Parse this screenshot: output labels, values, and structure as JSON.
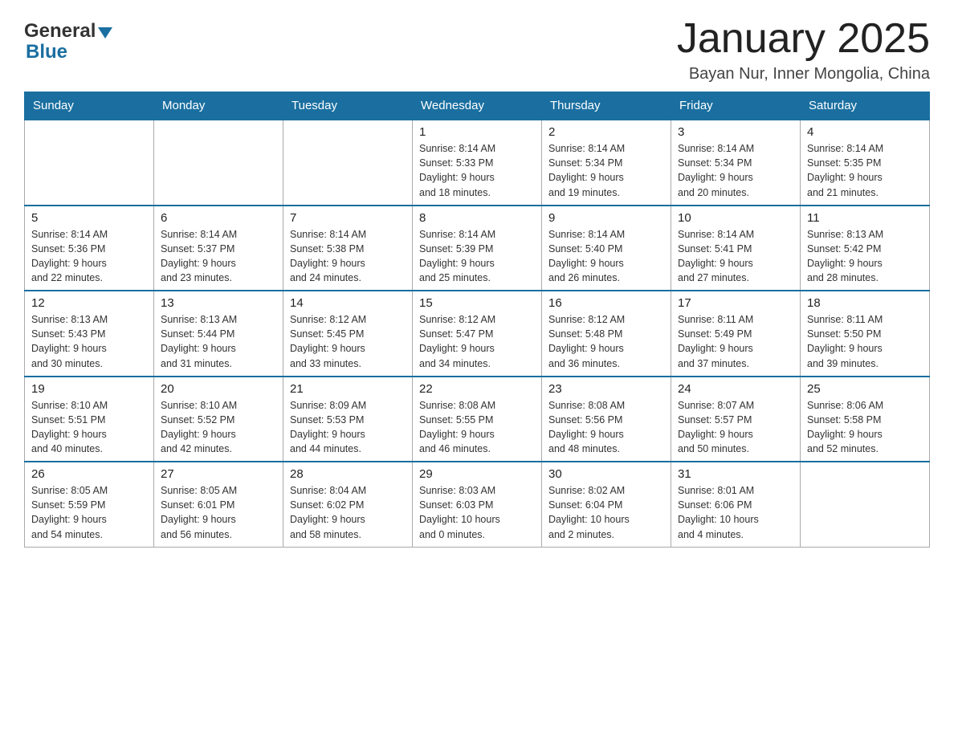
{
  "header": {
    "logo_general": "General",
    "logo_blue": "Blue",
    "month_title": "January 2025",
    "location": "Bayan Nur, Inner Mongolia, China"
  },
  "calendar": {
    "days_of_week": [
      "Sunday",
      "Monday",
      "Tuesday",
      "Wednesday",
      "Thursday",
      "Friday",
      "Saturday"
    ],
    "weeks": [
      {
        "days": [
          {
            "number": "",
            "info": ""
          },
          {
            "number": "",
            "info": ""
          },
          {
            "number": "",
            "info": ""
          },
          {
            "number": "1",
            "info": "Sunrise: 8:14 AM\nSunset: 5:33 PM\nDaylight: 9 hours\nand 18 minutes."
          },
          {
            "number": "2",
            "info": "Sunrise: 8:14 AM\nSunset: 5:34 PM\nDaylight: 9 hours\nand 19 minutes."
          },
          {
            "number": "3",
            "info": "Sunrise: 8:14 AM\nSunset: 5:34 PM\nDaylight: 9 hours\nand 20 minutes."
          },
          {
            "number": "4",
            "info": "Sunrise: 8:14 AM\nSunset: 5:35 PM\nDaylight: 9 hours\nand 21 minutes."
          }
        ]
      },
      {
        "days": [
          {
            "number": "5",
            "info": "Sunrise: 8:14 AM\nSunset: 5:36 PM\nDaylight: 9 hours\nand 22 minutes."
          },
          {
            "number": "6",
            "info": "Sunrise: 8:14 AM\nSunset: 5:37 PM\nDaylight: 9 hours\nand 23 minutes."
          },
          {
            "number": "7",
            "info": "Sunrise: 8:14 AM\nSunset: 5:38 PM\nDaylight: 9 hours\nand 24 minutes."
          },
          {
            "number": "8",
            "info": "Sunrise: 8:14 AM\nSunset: 5:39 PM\nDaylight: 9 hours\nand 25 minutes."
          },
          {
            "number": "9",
            "info": "Sunrise: 8:14 AM\nSunset: 5:40 PM\nDaylight: 9 hours\nand 26 minutes."
          },
          {
            "number": "10",
            "info": "Sunrise: 8:14 AM\nSunset: 5:41 PM\nDaylight: 9 hours\nand 27 minutes."
          },
          {
            "number": "11",
            "info": "Sunrise: 8:13 AM\nSunset: 5:42 PM\nDaylight: 9 hours\nand 28 minutes."
          }
        ]
      },
      {
        "days": [
          {
            "number": "12",
            "info": "Sunrise: 8:13 AM\nSunset: 5:43 PM\nDaylight: 9 hours\nand 30 minutes."
          },
          {
            "number": "13",
            "info": "Sunrise: 8:13 AM\nSunset: 5:44 PM\nDaylight: 9 hours\nand 31 minutes."
          },
          {
            "number": "14",
            "info": "Sunrise: 8:12 AM\nSunset: 5:45 PM\nDaylight: 9 hours\nand 33 minutes."
          },
          {
            "number": "15",
            "info": "Sunrise: 8:12 AM\nSunset: 5:47 PM\nDaylight: 9 hours\nand 34 minutes."
          },
          {
            "number": "16",
            "info": "Sunrise: 8:12 AM\nSunset: 5:48 PM\nDaylight: 9 hours\nand 36 minutes."
          },
          {
            "number": "17",
            "info": "Sunrise: 8:11 AM\nSunset: 5:49 PM\nDaylight: 9 hours\nand 37 minutes."
          },
          {
            "number": "18",
            "info": "Sunrise: 8:11 AM\nSunset: 5:50 PM\nDaylight: 9 hours\nand 39 minutes."
          }
        ]
      },
      {
        "days": [
          {
            "number": "19",
            "info": "Sunrise: 8:10 AM\nSunset: 5:51 PM\nDaylight: 9 hours\nand 40 minutes."
          },
          {
            "number": "20",
            "info": "Sunrise: 8:10 AM\nSunset: 5:52 PM\nDaylight: 9 hours\nand 42 minutes."
          },
          {
            "number": "21",
            "info": "Sunrise: 8:09 AM\nSunset: 5:53 PM\nDaylight: 9 hours\nand 44 minutes."
          },
          {
            "number": "22",
            "info": "Sunrise: 8:08 AM\nSunset: 5:55 PM\nDaylight: 9 hours\nand 46 minutes."
          },
          {
            "number": "23",
            "info": "Sunrise: 8:08 AM\nSunset: 5:56 PM\nDaylight: 9 hours\nand 48 minutes."
          },
          {
            "number": "24",
            "info": "Sunrise: 8:07 AM\nSunset: 5:57 PM\nDaylight: 9 hours\nand 50 minutes."
          },
          {
            "number": "25",
            "info": "Sunrise: 8:06 AM\nSunset: 5:58 PM\nDaylight: 9 hours\nand 52 minutes."
          }
        ]
      },
      {
        "days": [
          {
            "number": "26",
            "info": "Sunrise: 8:05 AM\nSunset: 5:59 PM\nDaylight: 9 hours\nand 54 minutes."
          },
          {
            "number": "27",
            "info": "Sunrise: 8:05 AM\nSunset: 6:01 PM\nDaylight: 9 hours\nand 56 minutes."
          },
          {
            "number": "28",
            "info": "Sunrise: 8:04 AM\nSunset: 6:02 PM\nDaylight: 9 hours\nand 58 minutes."
          },
          {
            "number": "29",
            "info": "Sunrise: 8:03 AM\nSunset: 6:03 PM\nDaylight: 10 hours\nand 0 minutes."
          },
          {
            "number": "30",
            "info": "Sunrise: 8:02 AM\nSunset: 6:04 PM\nDaylight: 10 hours\nand 2 minutes."
          },
          {
            "number": "31",
            "info": "Sunrise: 8:01 AM\nSunset: 6:06 PM\nDaylight: 10 hours\nand 4 minutes."
          },
          {
            "number": "",
            "info": ""
          }
        ]
      }
    ]
  }
}
